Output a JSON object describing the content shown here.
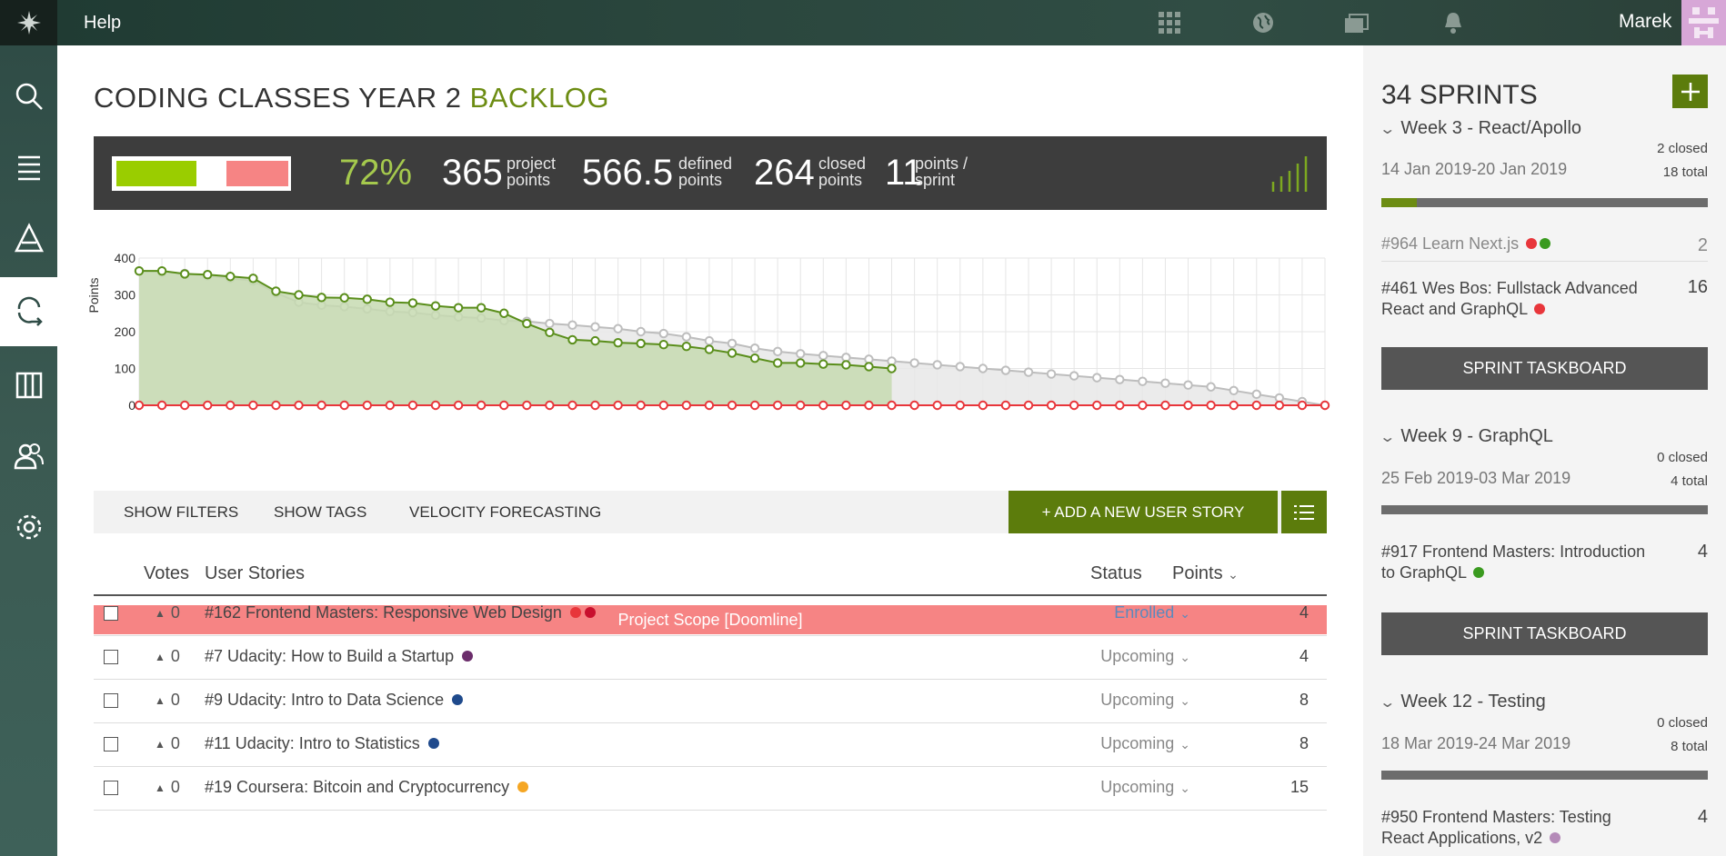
{
  "topbar": {
    "help": "Help",
    "user_name": "Marek",
    "icons": [
      "apps-grid-icon",
      "globe-icon",
      "folders-icon",
      "bell-icon"
    ]
  },
  "sidebar": {
    "items": [
      "search-icon",
      "list-icon",
      "triangle-icon",
      "backlog-loop-icon",
      "columns-icon",
      "people-icon",
      "settings-gear-icon"
    ],
    "active": "backlog-loop-icon"
  },
  "page": {
    "title_main": "CODING CLASSES YEAR 2",
    "title_accent": "BACKLOG"
  },
  "stats": {
    "percent": "72%",
    "project_points": "365",
    "project_label_1": "project",
    "project_label_2": "points",
    "defined_points": "566.5",
    "defined_label_1": "defined",
    "defined_label_2": "points",
    "closed_points": "264",
    "closed_label_1": "closed",
    "closed_label_2": "points",
    "velocity": "11",
    "velocity_label_1": "points /",
    "velocity_label_2": "sprint",
    "progress_closed_fraction": 0.46,
    "progress_total_fraction": 0.72
  },
  "chart_data": {
    "type": "line",
    "ylabel": "Points",
    "ylim": [
      0,
      400
    ],
    "yticks": [
      0,
      100,
      200,
      300,
      400
    ],
    "x": [
      1,
      2,
      3,
      4,
      5,
      6,
      7,
      8,
      9,
      10,
      11,
      12,
      13,
      14,
      15,
      16,
      17,
      18,
      19,
      20,
      21,
      22,
      23,
      24,
      25,
      26,
      27,
      28,
      29,
      30,
      31,
      32,
      33,
      34,
      35,
      36,
      37,
      38,
      39,
      40,
      41,
      42,
      43,
      44,
      45,
      46,
      47,
      48,
      49,
      50,
      51,
      52,
      53
    ],
    "series": [
      {
        "name": "",
        "values": [
          365,
          365,
          357,
          355,
          350,
          345,
          310,
          300,
          293,
          292,
          288,
          280,
          278,
          270,
          265,
          265,
          250,
          222,
          198,
          178,
          175,
          170,
          168,
          165,
          160,
          152,
          142,
          128,
          115,
          115,
          112,
          110,
          105,
          100
        ]
      },
      {
        "name": "",
        "values": [
          365,
          362,
          358,
          352,
          345,
          338,
          305,
          280,
          272,
          268,
          262,
          255,
          252,
          245,
          240,
          237,
          230,
          228,
          222,
          218,
          213,
          208,
          200,
          195,
          186,
          175,
          168,
          155,
          146,
          140,
          135,
          130,
          125,
          120,
          115,
          110,
          105,
          100,
          95,
          90,
          85,
          80,
          75,
          70,
          65,
          60,
          55,
          50,
          40,
          30,
          20,
          10,
          0
        ]
      },
      {
        "name": "",
        "values": [
          0,
          0,
          0,
          0,
          0,
          0,
          0,
          0,
          0,
          0,
          0,
          0,
          0,
          0,
          0,
          0,
          0,
          0,
          0,
          0,
          0,
          0,
          0,
          0,
          0,
          0,
          0,
          0,
          0,
          0,
          0,
          0,
          0,
          0,
          0,
          0,
          0,
          0,
          0,
          0,
          0,
          0,
          0,
          0,
          0,
          0,
          0,
          0,
          0,
          0,
          0,
          0,
          0
        ]
      }
    ],
    "colors": {
      "closed": "#5a8e1b",
      "closed_fill": "#c7dbb1",
      "projected": "#bdbdbd",
      "projected_fill": "#e8e8e8",
      "doomline": "#e8363b"
    }
  },
  "toolbar": {
    "show_filters": "SHOW FILTERS",
    "show_tags": "SHOW TAGS",
    "velocity_forecasting": "VELOCITY FORECASTING",
    "add_story": "+ ADD A NEW USER STORY"
  },
  "table": {
    "col_votes": "Votes",
    "col_stories": "User Stories",
    "col_status": "Status",
    "col_points": "Points",
    "scope_banner": "Project Scope [Doomline]",
    "rows": [
      {
        "votes": "0",
        "title": "#162 Frontend Masters: Responsive Web Design",
        "dots": [
          "#e8363b",
          "#c8102e"
        ],
        "status": "Enrolled",
        "points": "4"
      },
      {
        "votes": "0",
        "title": "#7 Udacity: How to Build a Startup",
        "dots": [
          "#6b2d6b"
        ],
        "status": "Upcoming",
        "points": "4"
      },
      {
        "votes": "0",
        "title": "#9 Udacity: Intro to Data Science",
        "dots": [
          "#1f4a8c"
        ],
        "status": "Upcoming",
        "points": "8"
      },
      {
        "votes": "0",
        "title": "#11 Udacity: Intro to Statistics",
        "dots": [
          "#1f4a8c"
        ],
        "status": "Upcoming",
        "points": "8"
      },
      {
        "votes": "0",
        "title": "#19 Coursera: Bitcoin and Cryptocurrency",
        "dots": [
          "#f5a623"
        ],
        "status": "Upcoming",
        "points": "15"
      }
    ]
  },
  "sprints": {
    "title": "34 SPRINTS",
    "taskboard_label": "SPRINT TASKBOARD",
    "list": [
      {
        "name": "Week 3 - React/Apollo",
        "closed": "2 closed",
        "dates": "14 Jan 2019-20 Jan 2019",
        "total": "18 total",
        "progress": 0.11,
        "stories": [
          {
            "title": "#964 Learn Next.js",
            "points": "2",
            "dots": [
              "#e8363b",
              "#3a9a1f"
            ],
            "muted": true
          },
          {
            "title": "#461 Wes Bos: Fullstack Advanced React and GraphQL",
            "points": "16",
            "dots": [
              "#e8363b"
            ],
            "muted": false
          }
        ]
      },
      {
        "name": "Week 9 - GraphQL",
        "closed": "0 closed",
        "dates": "25 Feb 2019-03 Mar 2019",
        "total": "4 total",
        "progress": 0,
        "stories": [
          {
            "title": "#917 Frontend Masters: Introduction to GraphQL",
            "points": "4",
            "dots": [
              "#3a9a1f"
            ],
            "muted": false
          }
        ]
      },
      {
        "name": "Week 12 - Testing",
        "closed": "0 closed",
        "dates": "18 Mar 2019-24 Mar 2019",
        "total": "8 total",
        "progress": 0,
        "stories": [
          {
            "title": "#950 Frontend Masters: Testing React Applications, v2",
            "points": "4",
            "dots": [
              "#b48ab8"
            ],
            "muted": false
          }
        ]
      }
    ]
  }
}
